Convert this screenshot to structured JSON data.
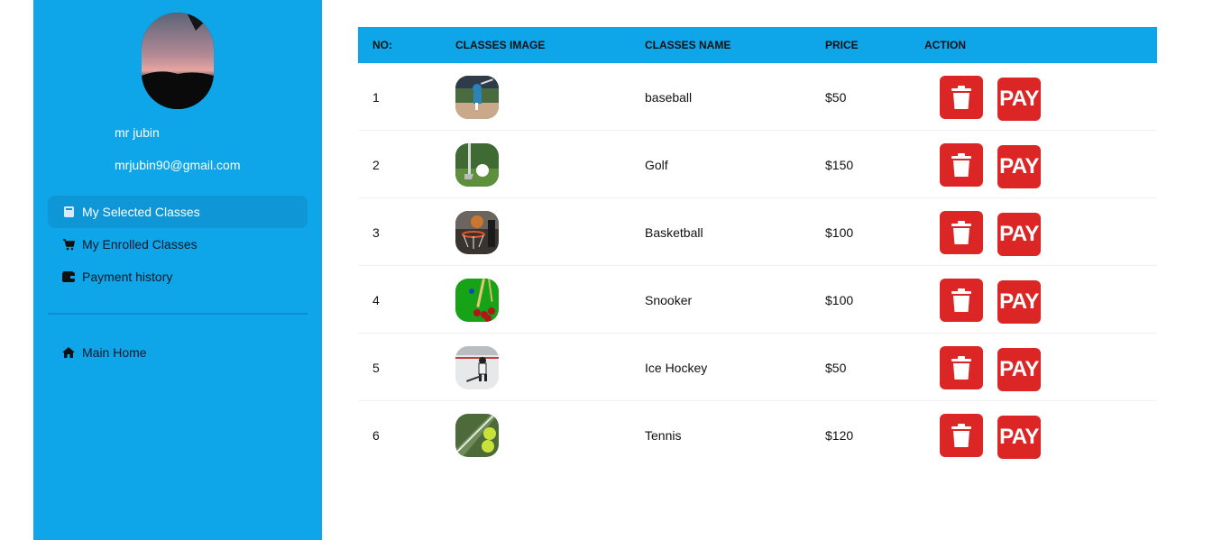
{
  "sidebar": {
    "user_name": "mr jubin",
    "user_email": "mrjubin90@gmail.com",
    "nav": [
      {
        "label": "My Selected Classes",
        "icon": "book-icon",
        "active": true
      },
      {
        "label": "My Enrolled Classes",
        "icon": "cart-icon",
        "active": false
      },
      {
        "label": "Payment history",
        "icon": "wallet-icon",
        "active": false
      }
    ],
    "home_label": "Main Home"
  },
  "table": {
    "headers": {
      "no": "NO:",
      "image": "CLASSES IMAGE",
      "name": "CLASSES NAME",
      "price": "PRICE",
      "action": "ACTION"
    },
    "rows": [
      {
        "no": "1",
        "name": "baseball",
        "price": "$50",
        "image_icon": "baseball-thumb"
      },
      {
        "no": "2",
        "name": "Golf",
        "price": "$150",
        "image_icon": "golf-thumb"
      },
      {
        "no": "3",
        "name": "Basketball",
        "price": "$100",
        "image_icon": "basketball-thumb"
      },
      {
        "no": "4",
        "name": "Snooker",
        "price": "$100",
        "image_icon": "snooker-thumb"
      },
      {
        "no": "5",
        "name": "Ice Hockey",
        "price": "$50",
        "image_icon": "ice-hockey-thumb"
      },
      {
        "no": "6",
        "name": "Tennis",
        "price": "$120",
        "image_icon": "tennis-thumb"
      }
    ],
    "pay_label": "PAY"
  },
  "colors": {
    "accent": "#0ea5e9",
    "danger": "#dc2626"
  }
}
